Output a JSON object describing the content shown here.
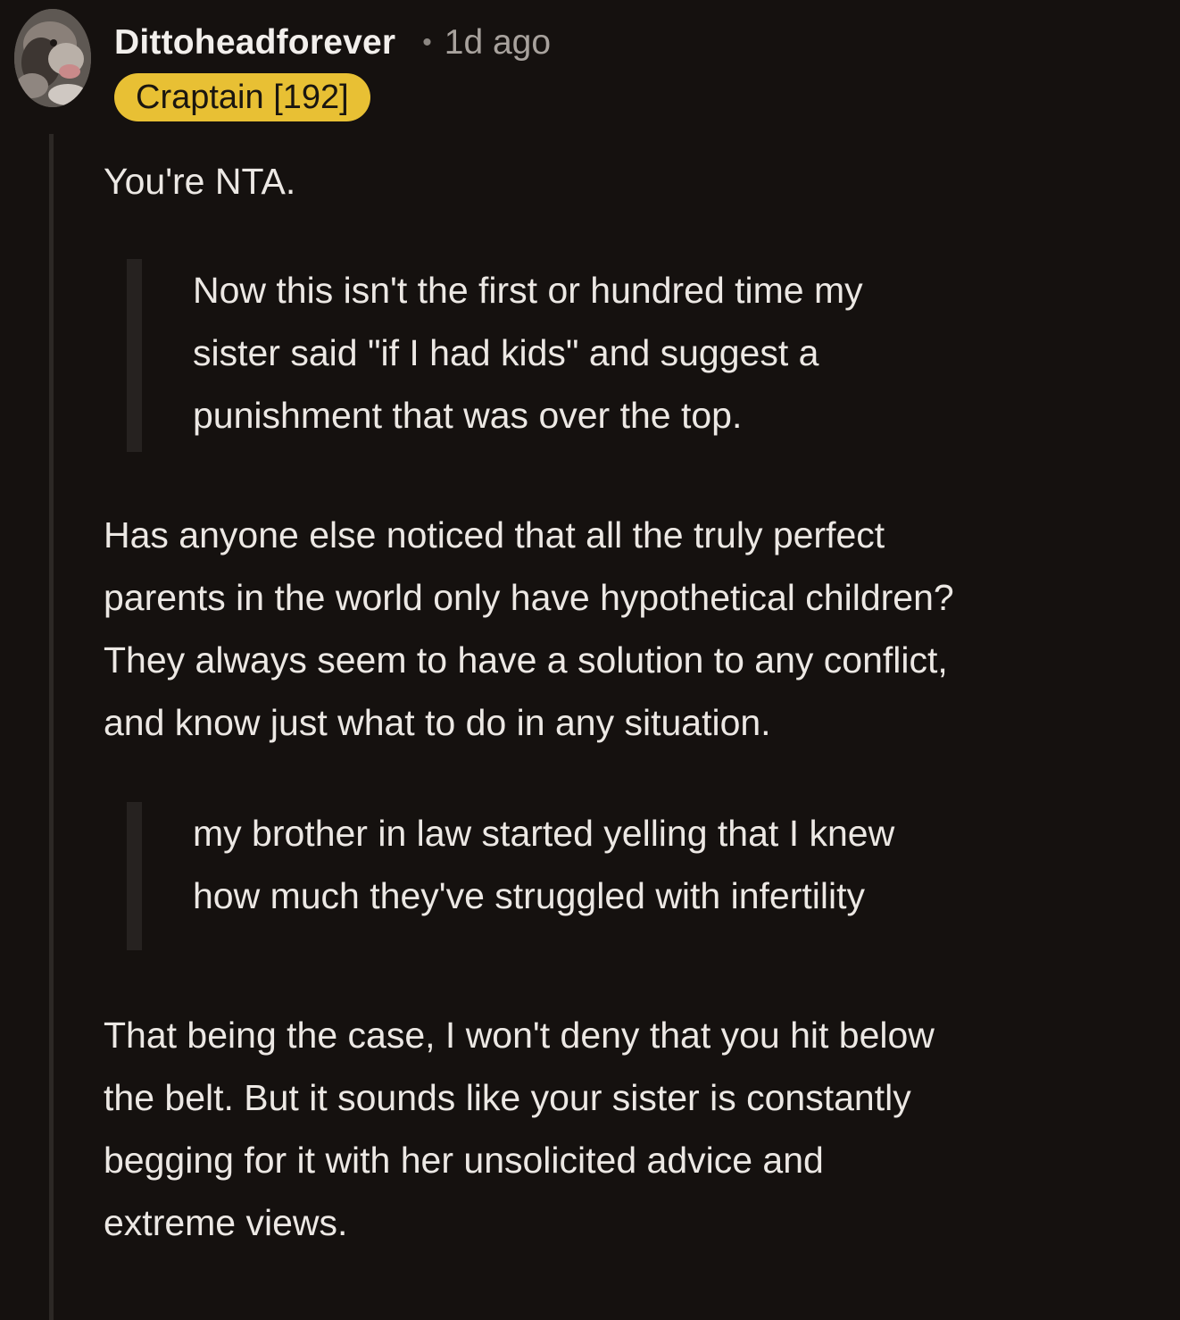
{
  "comment": {
    "author": "Dittoheadforever",
    "separator": "•",
    "time": "1d ago",
    "flair": "Craptain [192]",
    "paragraphs": {
      "p1": "You're NTA.",
      "q1": [
        "Now this isn't the first or hundred time my",
        "sister said \"if I had kids\" and suggest a",
        "punishment that was over the top."
      ],
      "p2": [
        "Has anyone else noticed that all the truly perfect",
        "parents in the world only have hypothetical children?",
        "They always seem to have a solution to any conflict,",
        "and know just what to do in any situation."
      ],
      "q2": [
        "my brother in law started yelling that I knew",
        "how much they've struggled with infertility"
      ],
      "p3": [
        "That being the case, I won't deny that you hit below",
        "the belt. But it sounds like your sister is constantly",
        "begging for it with her unsolicited advice and",
        "extreme views."
      ]
    }
  },
  "colors": {
    "background": "#15110f",
    "flair_bg": "#e8c034",
    "text": "#ece8e4",
    "muted": "#a8a29d"
  },
  "icons": {
    "avatar": "user-avatar-dog-photo"
  }
}
